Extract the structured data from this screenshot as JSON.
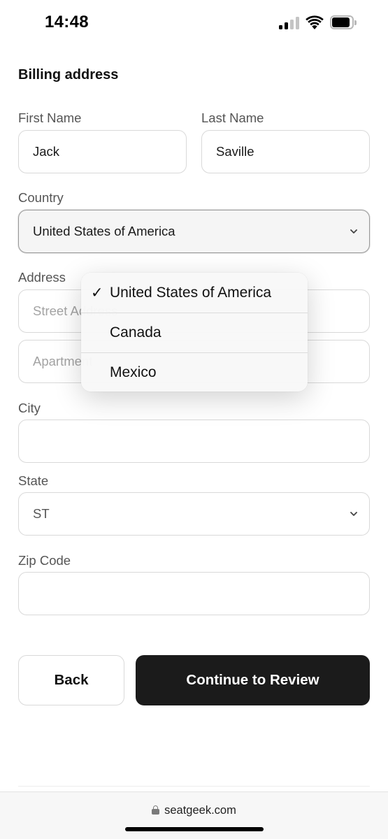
{
  "status_bar": {
    "time": "14:48",
    "icons": [
      "cellular-signal-icon",
      "wifi-icon",
      "battery-icon"
    ]
  },
  "form": {
    "section_title": "Billing address",
    "first_name": {
      "label": "First Name",
      "value": "Jack"
    },
    "last_name": {
      "label": "Last Name",
      "value": "Saville"
    },
    "country": {
      "label": "Country",
      "value": "United States of America"
    },
    "address": {
      "label": "Address",
      "street_placeholder": "Street Address",
      "apartment_placeholder": "Apartment"
    },
    "city": {
      "label": "City",
      "value": ""
    },
    "state": {
      "label": "State",
      "value": "ST"
    },
    "zip": {
      "label": "Zip Code",
      "value": ""
    }
  },
  "dropdown": {
    "options": [
      {
        "label": "United States of America",
        "selected": true,
        "check": "✓"
      },
      {
        "label": "Canada",
        "selected": false
      },
      {
        "label": "Mexico",
        "selected": false
      }
    ]
  },
  "buttons": {
    "back_label": "Back",
    "continue_label": "Continue to Review"
  },
  "browser": {
    "url": "seatgeek.com"
  },
  "colors": {
    "primary_button_bg": "#1b1b1b",
    "primary_button_text": "#ffffff",
    "border": "#d9d9d9",
    "label": "#555555",
    "placeholder": "#a3a3a3"
  }
}
